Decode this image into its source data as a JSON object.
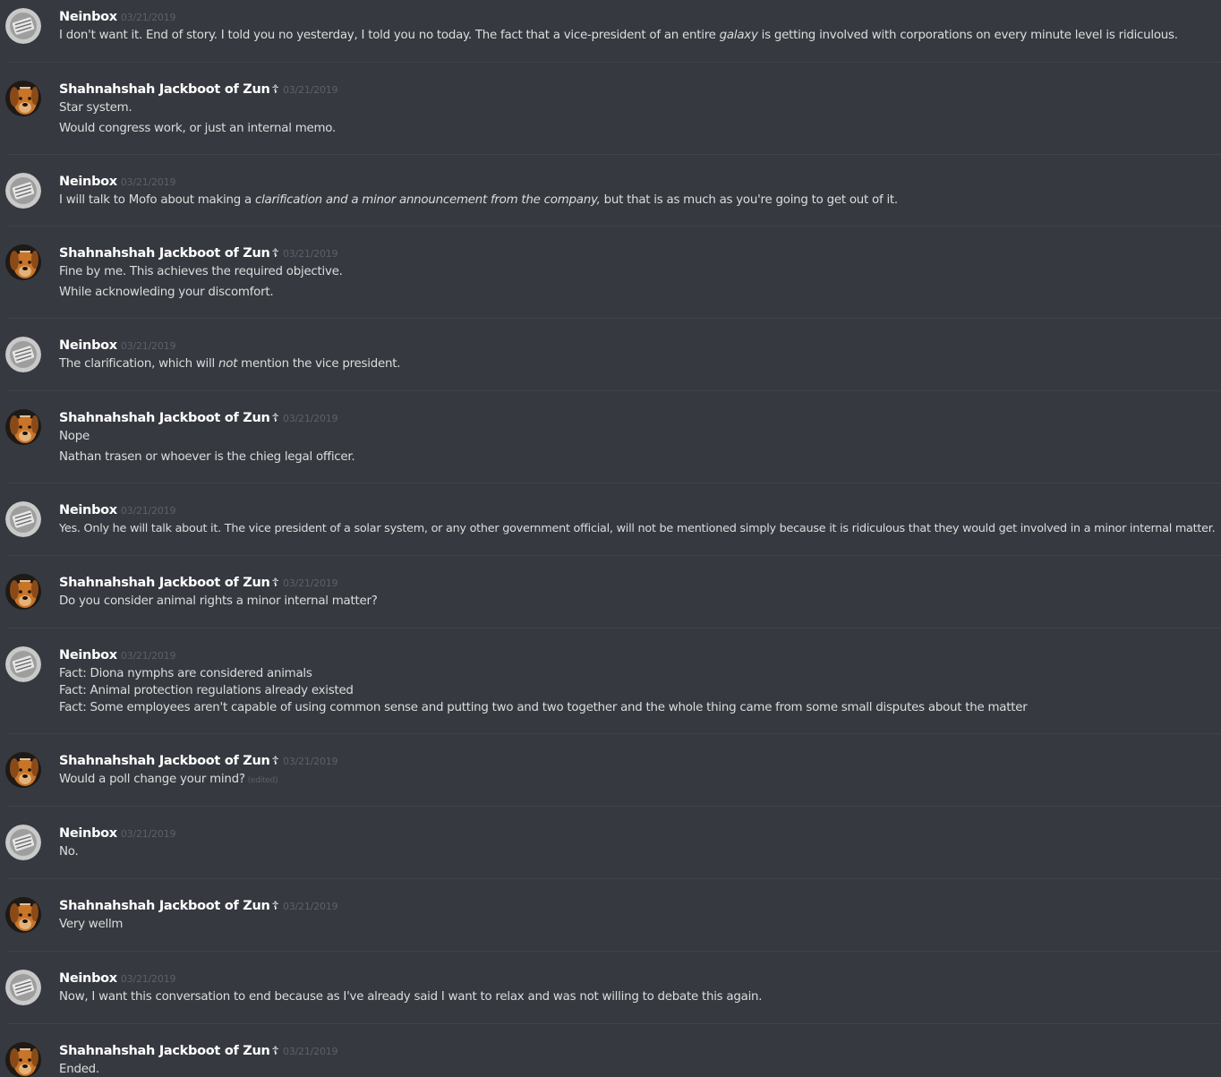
{
  "users": {
    "neinbox": {
      "name": "Neinbox",
      "avatar_icon": "neinbox-avatar-icon"
    },
    "shah": {
      "name": "Shahnahshah Jackboot of Zun",
      "badge": "☦",
      "avatar_icon": "dog-avatar-icon"
    }
  },
  "messages": [
    {
      "author": "neinbox",
      "name": "Neinbox",
      "timestamp": "03/21/2019",
      "lines": [
        {
          "parts": [
            "I don't want it. End of story. I told you no yesterday, I told you no today. The fact that a vice-president of an entire ",
            "galaxy",
            " is getting involved with corporations on every minute level is ridiculous."
          ]
        }
      ]
    },
    {
      "author": "shah",
      "name": "Shahnahshah Jackboot of Zun",
      "badge": "☦",
      "timestamp": "03/21/2019",
      "lines": [
        {
          "parts": [
            "Star system."
          ]
        },
        {
          "parts": [
            "Would congress work, or just an internal memo."
          ]
        }
      ]
    },
    {
      "author": "neinbox",
      "name": "Neinbox",
      "timestamp": "03/21/2019",
      "lines": [
        {
          "parts": [
            "I will talk to Mofo about making a ",
            "clarification and a minor announcement from the company,",
            " but that is as much as you're going to get out of it."
          ]
        }
      ]
    },
    {
      "author": "shah",
      "name": "Shahnahshah Jackboot of Zun",
      "badge": "☦",
      "timestamp": "03/21/2019",
      "lines": [
        {
          "parts": [
            "Fine by me. This achieves the required objective."
          ]
        },
        {
          "parts": [
            "While acknowleding your discomfort."
          ]
        }
      ]
    },
    {
      "author": "neinbox",
      "name": "Neinbox",
      "timestamp": "03/21/2019",
      "lines": [
        {
          "parts": [
            "The clarification, which will ",
            "not",
            " mention the vice president."
          ]
        }
      ]
    },
    {
      "author": "shah",
      "name": "Shahnahshah Jackboot of Zun",
      "badge": "☦",
      "timestamp": "03/21/2019",
      "lines": [
        {
          "parts": [
            "Nope"
          ]
        },
        {
          "parts": [
            "Nathan trasen or whoever is the chieg legal officer."
          ]
        }
      ]
    },
    {
      "author": "neinbox",
      "name": "Neinbox",
      "timestamp": "03/21/2019",
      "lines": [
        {
          "parts": [
            "Yes. Only he will talk about it. The vice president of a solar system, or any other government official, will not be mentioned simply because it is ridiculous that they would get involved in a minor internal matter."
          ]
        }
      ]
    },
    {
      "author": "shah",
      "name": "Shahnahshah Jackboot of Zun",
      "badge": "☦",
      "timestamp": "03/21/2019",
      "lines": [
        {
          "parts": [
            "Do you consider animal rights a minor internal matter?"
          ]
        }
      ]
    },
    {
      "author": "neinbox",
      "name": "Neinbox",
      "timestamp": "03/21/2019",
      "lines": [
        {
          "parts": [
            "Fact: Diona nymphs are considered animals"
          ]
        },
        {
          "parts": [
            "Fact: Animal protection regulations already existed"
          ]
        },
        {
          "parts": [
            "Fact: Some employees aren't capable of using common sense and putting two and two together and the whole thing came from some small disputes about the matter"
          ]
        }
      ]
    },
    {
      "author": "shah",
      "name": "Shahnahshah Jackboot of Zun",
      "badge": "☦",
      "timestamp": "03/21/2019",
      "lines": [
        {
          "parts": [
            "Would a poll change your mind?"
          ],
          "edited": "(edited)"
        }
      ]
    },
    {
      "author": "neinbox",
      "name": "Neinbox",
      "timestamp": "03/21/2019",
      "lines": [
        {
          "parts": [
            "No."
          ]
        }
      ]
    },
    {
      "author": "shah",
      "name": "Shahnahshah Jackboot of Zun",
      "badge": "☦",
      "timestamp": "03/21/2019",
      "lines": [
        {
          "parts": [
            "Very wellm"
          ]
        }
      ]
    },
    {
      "author": "neinbox",
      "name": "Neinbox",
      "timestamp": "03/21/2019",
      "lines": [
        {
          "parts": [
            "Now, I want this conversation to end because as I've already said I want to relax and was not willing to debate this again."
          ]
        }
      ]
    },
    {
      "author": "shah",
      "name": "Shahnahshah Jackboot of Zun",
      "badge": "☦",
      "timestamp": "03/21/2019",
      "lines": [
        {
          "parts": [
            "Ended."
          ]
        }
      ]
    }
  ]
}
